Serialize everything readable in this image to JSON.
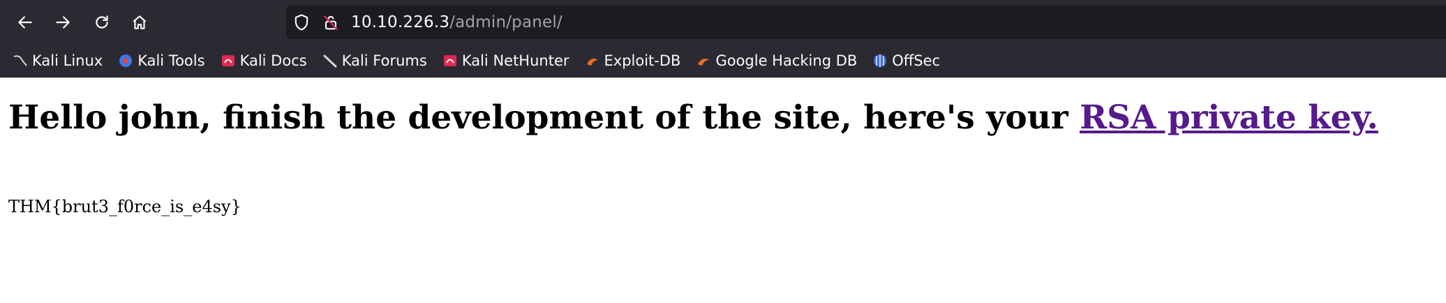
{
  "browser": {
    "url_host": "10.10.226.3",
    "url_path": "/admin/panel/",
    "bookmarks": [
      {
        "label": "Kali Linux",
        "icon": "kali-dragon-icon"
      },
      {
        "label": "Kali Tools",
        "icon": "kali-tools-icon"
      },
      {
        "label": "Kali Docs",
        "icon": "kali-docs-icon"
      },
      {
        "label": "Kali Forums",
        "icon": "kali-forums-icon"
      },
      {
        "label": "Kali NetHunter",
        "icon": "kali-nethunter-icon"
      },
      {
        "label": "Exploit-DB",
        "icon": "exploit-db-icon"
      },
      {
        "label": "Google Hacking DB",
        "icon": "ghdb-icon"
      },
      {
        "label": "OffSec",
        "icon": "offsec-icon"
      }
    ]
  },
  "page": {
    "heading_text": "Hello john, finish the development of the site, here's your",
    "heading_link": "RSA private key.",
    "flag": "THM{brut3_f0rce_is_e4sy}"
  }
}
